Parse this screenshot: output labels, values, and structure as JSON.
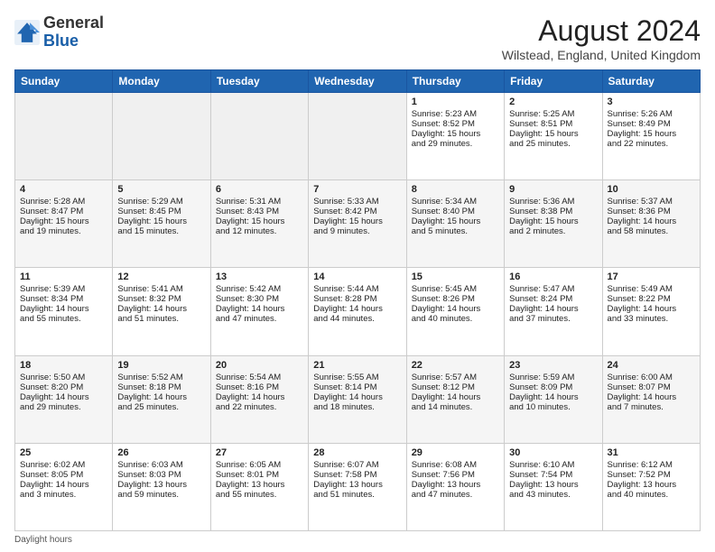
{
  "header": {
    "logo_general": "General",
    "logo_blue": "Blue",
    "month_title": "August 2024",
    "location": "Wilstead, England, United Kingdom"
  },
  "days_of_week": [
    "Sunday",
    "Monday",
    "Tuesday",
    "Wednesday",
    "Thursday",
    "Friday",
    "Saturday"
  ],
  "footnote": "Daylight hours",
  "weeks": [
    [
      {
        "day": "",
        "info": "",
        "empty": true
      },
      {
        "day": "",
        "info": "",
        "empty": true
      },
      {
        "day": "",
        "info": "",
        "empty": true
      },
      {
        "day": "",
        "info": "",
        "empty": true
      },
      {
        "day": "1",
        "info": "Sunrise: 5:23 AM\nSunset: 8:52 PM\nDaylight: 15 hours\nand 29 minutes.",
        "empty": false
      },
      {
        "day": "2",
        "info": "Sunrise: 5:25 AM\nSunset: 8:51 PM\nDaylight: 15 hours\nand 25 minutes.",
        "empty": false
      },
      {
        "day": "3",
        "info": "Sunrise: 5:26 AM\nSunset: 8:49 PM\nDaylight: 15 hours\nand 22 minutes.",
        "empty": false
      }
    ],
    [
      {
        "day": "4",
        "info": "Sunrise: 5:28 AM\nSunset: 8:47 PM\nDaylight: 15 hours\nand 19 minutes.",
        "empty": false
      },
      {
        "day": "5",
        "info": "Sunrise: 5:29 AM\nSunset: 8:45 PM\nDaylight: 15 hours\nand 15 minutes.",
        "empty": false
      },
      {
        "day": "6",
        "info": "Sunrise: 5:31 AM\nSunset: 8:43 PM\nDaylight: 15 hours\nand 12 minutes.",
        "empty": false
      },
      {
        "day": "7",
        "info": "Sunrise: 5:33 AM\nSunset: 8:42 PM\nDaylight: 15 hours\nand 9 minutes.",
        "empty": false
      },
      {
        "day": "8",
        "info": "Sunrise: 5:34 AM\nSunset: 8:40 PM\nDaylight: 15 hours\nand 5 minutes.",
        "empty": false
      },
      {
        "day": "9",
        "info": "Sunrise: 5:36 AM\nSunset: 8:38 PM\nDaylight: 15 hours\nand 2 minutes.",
        "empty": false
      },
      {
        "day": "10",
        "info": "Sunrise: 5:37 AM\nSunset: 8:36 PM\nDaylight: 14 hours\nand 58 minutes.",
        "empty": false
      }
    ],
    [
      {
        "day": "11",
        "info": "Sunrise: 5:39 AM\nSunset: 8:34 PM\nDaylight: 14 hours\nand 55 minutes.",
        "empty": false
      },
      {
        "day": "12",
        "info": "Sunrise: 5:41 AM\nSunset: 8:32 PM\nDaylight: 14 hours\nand 51 minutes.",
        "empty": false
      },
      {
        "day": "13",
        "info": "Sunrise: 5:42 AM\nSunset: 8:30 PM\nDaylight: 14 hours\nand 47 minutes.",
        "empty": false
      },
      {
        "day": "14",
        "info": "Sunrise: 5:44 AM\nSunset: 8:28 PM\nDaylight: 14 hours\nand 44 minutes.",
        "empty": false
      },
      {
        "day": "15",
        "info": "Sunrise: 5:45 AM\nSunset: 8:26 PM\nDaylight: 14 hours\nand 40 minutes.",
        "empty": false
      },
      {
        "day": "16",
        "info": "Sunrise: 5:47 AM\nSunset: 8:24 PM\nDaylight: 14 hours\nand 37 minutes.",
        "empty": false
      },
      {
        "day": "17",
        "info": "Sunrise: 5:49 AM\nSunset: 8:22 PM\nDaylight: 14 hours\nand 33 minutes.",
        "empty": false
      }
    ],
    [
      {
        "day": "18",
        "info": "Sunrise: 5:50 AM\nSunset: 8:20 PM\nDaylight: 14 hours\nand 29 minutes.",
        "empty": false
      },
      {
        "day": "19",
        "info": "Sunrise: 5:52 AM\nSunset: 8:18 PM\nDaylight: 14 hours\nand 25 minutes.",
        "empty": false
      },
      {
        "day": "20",
        "info": "Sunrise: 5:54 AM\nSunset: 8:16 PM\nDaylight: 14 hours\nand 22 minutes.",
        "empty": false
      },
      {
        "day": "21",
        "info": "Sunrise: 5:55 AM\nSunset: 8:14 PM\nDaylight: 14 hours\nand 18 minutes.",
        "empty": false
      },
      {
        "day": "22",
        "info": "Sunrise: 5:57 AM\nSunset: 8:12 PM\nDaylight: 14 hours\nand 14 minutes.",
        "empty": false
      },
      {
        "day": "23",
        "info": "Sunrise: 5:59 AM\nSunset: 8:09 PM\nDaylight: 14 hours\nand 10 minutes.",
        "empty": false
      },
      {
        "day": "24",
        "info": "Sunrise: 6:00 AM\nSunset: 8:07 PM\nDaylight: 14 hours\nand 7 minutes.",
        "empty": false
      }
    ],
    [
      {
        "day": "25",
        "info": "Sunrise: 6:02 AM\nSunset: 8:05 PM\nDaylight: 14 hours\nand 3 minutes.",
        "empty": false
      },
      {
        "day": "26",
        "info": "Sunrise: 6:03 AM\nSunset: 8:03 PM\nDaylight: 13 hours\nand 59 minutes.",
        "empty": false
      },
      {
        "day": "27",
        "info": "Sunrise: 6:05 AM\nSunset: 8:01 PM\nDaylight: 13 hours\nand 55 minutes.",
        "empty": false
      },
      {
        "day": "28",
        "info": "Sunrise: 6:07 AM\nSunset: 7:58 PM\nDaylight: 13 hours\nand 51 minutes.",
        "empty": false
      },
      {
        "day": "29",
        "info": "Sunrise: 6:08 AM\nSunset: 7:56 PM\nDaylight: 13 hours\nand 47 minutes.",
        "empty": false
      },
      {
        "day": "30",
        "info": "Sunrise: 6:10 AM\nSunset: 7:54 PM\nDaylight: 13 hours\nand 43 minutes.",
        "empty": false
      },
      {
        "day": "31",
        "info": "Sunrise: 6:12 AM\nSunset: 7:52 PM\nDaylight: 13 hours\nand 40 minutes.",
        "empty": false
      }
    ]
  ]
}
